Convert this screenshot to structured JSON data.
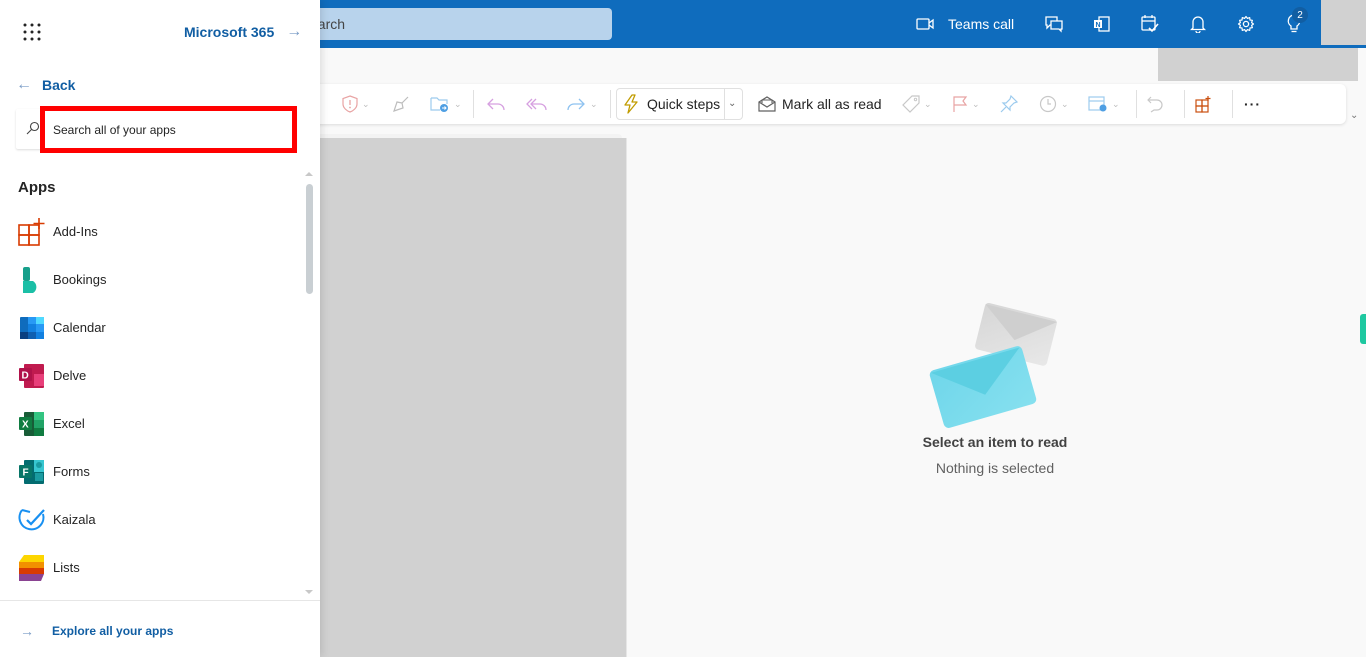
{
  "topbar": {
    "search_placeholder": "Search",
    "search_visible_text": "earch",
    "teams_call_label": "Teams call",
    "icons": [
      "video-camera-icon",
      "chat-feedback-icon",
      "onenote-icon",
      "calendar-check-icon",
      "bell-icon",
      "gear-icon",
      "lightbulb-icon"
    ],
    "tips_badge_count": "2",
    "brand_color": "#0f6cbd"
  },
  "ribbon": {
    "quick_steps_label": "Quick steps",
    "mark_all_read_label": "Mark all as read",
    "more_label": "···",
    "icons": [
      "report-shield-icon",
      "sweep-icon",
      "move-folder-icon",
      "reply-icon",
      "reply-all-icon",
      "forward-icon",
      "lightning-icon",
      "envelope-open-icon",
      "tag-icon",
      "flag-icon",
      "pin-icon",
      "clock-icon",
      "rules-icon",
      "undo-icon",
      "add-ins-icon",
      "more-icon"
    ]
  },
  "reading_pane": {
    "title": "Select an item to read",
    "subtitle": "Nothing is selected"
  },
  "panel": {
    "brand_label": "Microsoft 365",
    "back_label": "Back",
    "search_placeholder": "Search all of your apps",
    "apps_heading": "Apps",
    "apps": [
      {
        "label": "Add-Ins",
        "icon": "add-ins-icon"
      },
      {
        "label": "Bookings",
        "icon": "bookings-icon"
      },
      {
        "label": "Calendar",
        "icon": "calendar-icon"
      },
      {
        "label": "Delve",
        "icon": "delve-icon"
      },
      {
        "label": "Excel",
        "icon": "excel-icon"
      },
      {
        "label": "Forms",
        "icon": "forms-icon"
      },
      {
        "label": "Kaizala",
        "icon": "kaizala-icon"
      },
      {
        "label": "Lists",
        "icon": "lists-icon"
      }
    ],
    "explore_label": "Explore all your apps",
    "highlight_color": "#ff0000"
  }
}
